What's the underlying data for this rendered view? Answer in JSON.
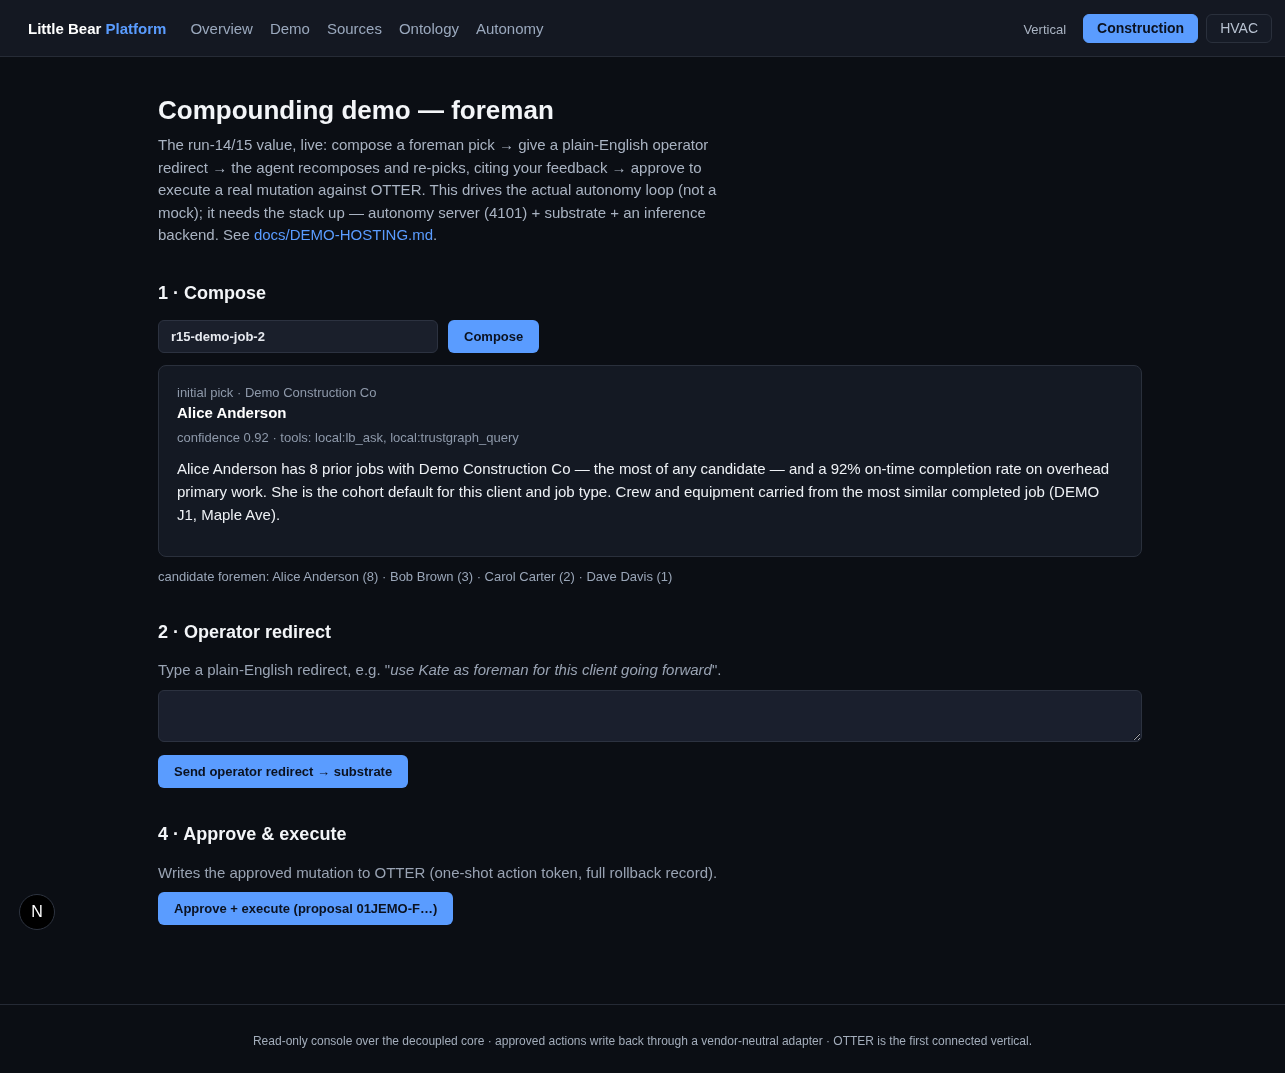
{
  "header": {
    "brand": {
      "name": "Little Bear",
      "accent": "Platform"
    },
    "nav": [
      {
        "label": "Overview"
      },
      {
        "label": "Demo"
      },
      {
        "label": "Sources"
      },
      {
        "label": "Ontology"
      },
      {
        "label": "Autonomy"
      }
    ],
    "vertical": {
      "label": "Vertical",
      "options": [
        {
          "label": "Construction",
          "selected": true
        },
        {
          "label": "HVAC",
          "selected": false
        }
      ]
    }
  },
  "page": {
    "title": "Compounding demo — foreman",
    "intro": {
      "text": "The run-14/15 value, live: compose a foreman pick → give a plain-English operator redirect → the agent recomposes and re-picks, citing your feedback → approve to execute a real mutation against OTTER. This drives the actual autonomy loop (not a mock); it needs the stack up — autonomy server (4101) + substrate + an inference backend. See ",
      "link": "docs/DEMO-HOSTING.md",
      "after": "."
    }
  },
  "compose": {
    "heading": "1 · Compose",
    "job_field": {
      "value": "r15-demo-job-2"
    },
    "button": "Compose",
    "pick": {
      "meta": "initial pick · Demo Construction Co",
      "name": "Alice Anderson",
      "details": "confidence 0.92 · tools: local:lb_ask, local:trustgraph_query",
      "rationale": "Alice Anderson has 8 prior jobs with Demo Construction Co — the most of any candidate — and a 92% on-time completion rate on overhead primary work. She is the cohort default for this client and job type. Crew and equipment carried from the most similar completed job (DEMO J1, Maple Ave)."
    },
    "candidates": "candidate foremen: Alice Anderson (8) · Bob Brown (3) · Carol Carter (2) · Dave Davis (1)"
  },
  "redirect": {
    "heading": "2 · Operator redirect",
    "hint": "Type a plain-English redirect, e.g. \"*use Kate as foreman for this client going forward*\".",
    "button": "Send operator redirect → substrate"
  },
  "approve": {
    "heading": "4 · Approve & execute",
    "text": "Writes the approved mutation to OTTER (one-shot action token, full rollback record).",
    "button": "Approve + execute (proposal 01JEMO-F…)"
  },
  "dev_badge": {
    "label": "N"
  },
  "footer": {
    "text": "Read-only console over the decoupled core · approved actions write back through a vendor-neutral adapter · OTTER is the first connected vertical."
  }
}
